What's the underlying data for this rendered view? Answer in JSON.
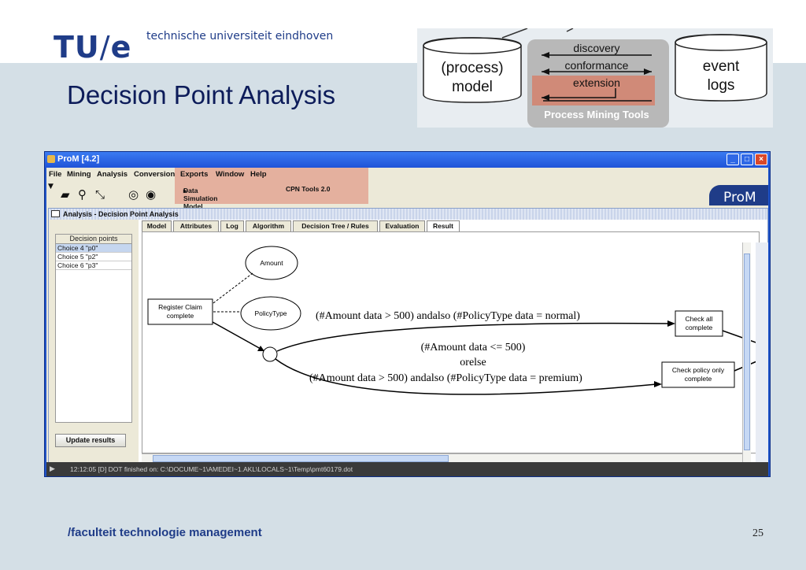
{
  "slide": {
    "logo_left": "TU",
    "logo_slash": "/",
    "logo_right": "e",
    "tagline": "technische universiteit eindhoven",
    "title": "Decision Point Analysis",
    "footer": "/faculteit technologie management",
    "page_number": "25"
  },
  "framework": {
    "model_label_1": "(process)",
    "model_label_2": "model",
    "logs_label_1": "event",
    "logs_label_2": "logs",
    "arrow_discovery": "discovery",
    "arrow_conformance": "conformance",
    "arrow_extension": "extension",
    "tools_label": "Process Mining Tools",
    "colors": {
      "extension_highlight": "#d08a78",
      "tools_bg": "#b8b8b8"
    }
  },
  "window": {
    "title": "ProM [4.2]",
    "menu": [
      "File",
      "Mining",
      "Analysis",
      "Conversion",
      "Exports",
      "Window",
      "Help"
    ],
    "exports_submenu": {
      "item": "Data Simulation Model No.2",
      "arrow": "▸",
      "sub_item": "CPN Tools 2.0"
    },
    "brand": "ProM",
    "inner_title": "Analysis - Decision Point Analysis",
    "decision_points": {
      "header": "Decision points",
      "items": [
        "Choice 4 \"p0\"",
        "Choice 5 \"p2\"",
        "Choice 6 \"p3\""
      ]
    },
    "update_button": "Update results",
    "tabs": [
      "Model",
      "Attributes",
      "Log",
      "Algorithm",
      "Decision Tree / Rules",
      "Evaluation",
      "Result"
    ],
    "active_tab": "Result",
    "graph": {
      "amount": "Amount",
      "policytype": "PolicyType",
      "register_1": "Register Claim",
      "register_2": "complete",
      "check_all_1": "Check all",
      "check_all_2": "complete",
      "check_policy_1": "Check policy only",
      "check_policy_2": "complete",
      "rule_top": "(#Amount data > 500) andalso (#PolicyType data = normal)",
      "rule_bottom_1": "(#Amount data <= 500)",
      "rule_bottom_2": "orelse",
      "rule_bottom_3": "(#Amount data > 500) andalso (#PolicyType data = premium)"
    },
    "status": "12:12:05 [D] DOT finished on: C:\\DOCUME~1\\AMEDEI~1.AKL\\LOCALS~1\\Temp\\pmt60179.dot"
  }
}
